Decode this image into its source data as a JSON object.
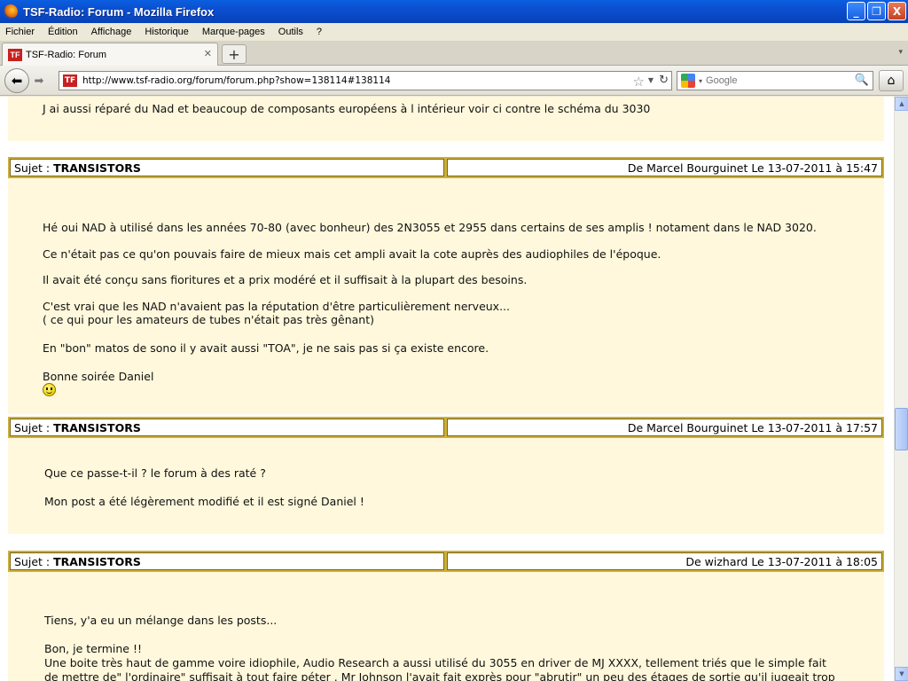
{
  "window": {
    "title": "TSF-Radio: Forum - Mozilla Firefox",
    "minimize": "_",
    "restore": "❐",
    "close": "X"
  },
  "menu": [
    "Fichier",
    "Édition",
    "Affichage",
    "Historique",
    "Marque-pages",
    "Outils",
    "?"
  ],
  "tab": {
    "label": "TSF-Radio: Forum",
    "close": "✕",
    "new_tab": "+",
    "scroll": "▾",
    "icon_text": "TF"
  },
  "nav": {
    "url": "http://www.tsf-radio.org/forum/forum.php?show=138114#138114",
    "search_placeholder": "Google",
    "star": "☆",
    "drop": "▼",
    "reload": "↻",
    "search_drop": "▾",
    "magnifier": "🔍",
    "home": "⌂",
    "back": "⬅",
    "forward": "➡"
  },
  "scrollbar": {
    "up": "▲",
    "down": "▼"
  },
  "posts": {
    "top_line": "J ai aussi réparé du Nad et beaucoup de composants européens à l intérieur voir ci contre le schéma du 3030",
    "post1": {
      "subject_label": "Sujet :",
      "subject": "TRANSISTORS",
      "author": "De Marcel Bourguinet  Le 13-07-2011 à 15:47",
      "lines": [
        "Hé oui NAD à utilisé dans les années 70-80 (avec bonheur) des 2N3055 et 2955 dans certains de ses amplis ! notament dans le NAD 3020.",
        "Ce n'était pas ce qu'on pouvais faire de mieux mais cet ampli avait la cote auprès des audiophiles de l'époque.",
        "Il avait été conçu sans fioritures et a prix modéré et il suffisait à la plupart des besoins.",
        "C'est vrai que les NAD n'avaient pas la réputation d'être particulièrement nerveux...",
        "( ce qui pour les amateurs de tubes n'était pas très gênant)",
        "En \"bon\" matos de sono il y avait aussi \"TOA\", je ne sais pas si ça existe encore.",
        "Bonne soirée Daniel"
      ]
    },
    "post2": {
      "subject_label": "Sujet :",
      "subject": "TRANSISTORS",
      "author": "De Marcel Bourguinet  Le 13-07-2011 à 17:57",
      "lines": [
        "Que ce passe-t-il ? le forum à des raté ?",
        "Mon post a été légèrement modifié et il est signé Daniel !"
      ]
    },
    "post3": {
      "subject_label": "Sujet :",
      "subject": "TRANSISTORS",
      "author": "De wizhard  Le 13-07-2011 à 18:05",
      "lines": [
        "Tiens, y'a eu un mélange dans les posts...",
        "Bon, je termine !!",
        "Une boite très haut de gamme voire idiophile, Audio Research a aussi utilisé du 3055 en driver de MJ XXXX, tellement triés que le simple fait",
        "de mettre de\" l'ordinaire\" suffisait à tout faire péter . Mr Johnson l'avait fait exprès pour \"abrutir\" un peu des étages de sortie qu'il jugeait trop"
      ]
    }
  }
}
